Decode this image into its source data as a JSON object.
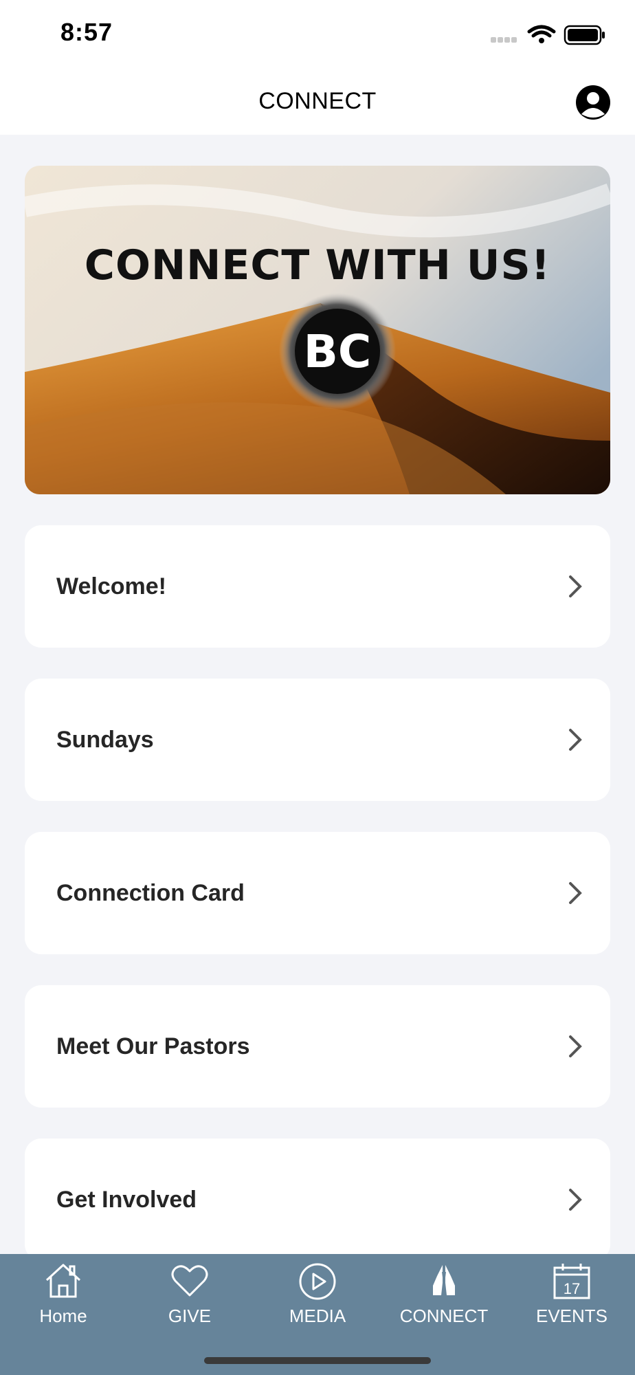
{
  "status_bar": {
    "time": "8:57"
  },
  "header": {
    "title": "CONNECT"
  },
  "hero": {
    "title": "CONNECT WITH US!",
    "logo_text": "BC"
  },
  "menu": [
    {
      "label": "Welcome!"
    },
    {
      "label": "Sundays"
    },
    {
      "label": "Connection Card"
    },
    {
      "label": "Meet Our Pastors"
    },
    {
      "label": "Get Involved"
    }
  ],
  "tabs": [
    {
      "label": "Home",
      "icon": "home-icon"
    },
    {
      "label": "GIVE",
      "icon": "heart-icon"
    },
    {
      "label": "MEDIA",
      "icon": "play-icon"
    },
    {
      "label": "CONNECT",
      "icon": "praying-hands-icon",
      "active": true
    },
    {
      "label": "EVENTS",
      "icon": "calendar-icon",
      "day": "17"
    }
  ],
  "colors": {
    "tab_bar": "#66849a",
    "background": "#f3f4f8",
    "card": "#ffffff"
  }
}
